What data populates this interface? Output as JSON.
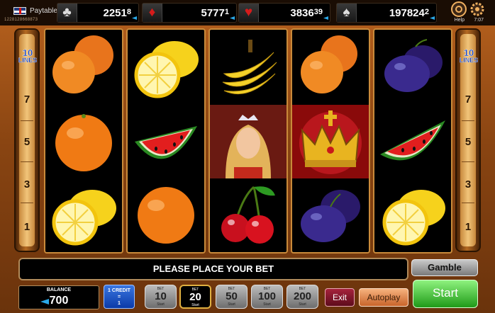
{
  "topbar": {
    "paytable_label": "Paytable",
    "ticket_id": "1228128668873",
    "help_label": "Help",
    "clock": "7:07"
  },
  "jackpots": [
    {
      "suit": "clubs",
      "symbol": "♣",
      "main": "2251",
      "cents": "8"
    },
    {
      "suit": "diamonds",
      "symbol": "♦",
      "main": "5777",
      "cents": "1"
    },
    {
      "suit": "hearts",
      "symbol": "♥",
      "main": "3836",
      "cents": "39"
    },
    {
      "suit": "spades",
      "symbol": "♠",
      "main": "197824",
      "cents": "2"
    }
  ],
  "lines": {
    "count": "10",
    "label": "LINES",
    "numbers": [
      "7",
      "5",
      "3",
      "1"
    ]
  },
  "reels": [
    [
      "orange-symbol",
      "orange-symbol",
      "lemon-symbol"
    ],
    [
      "lemon-symbol",
      "watermelon-symbol",
      "orange-symbol"
    ],
    [
      "banana-symbol",
      "princess-symbol",
      "cherry-symbol"
    ],
    [
      "orange-symbol",
      "crown-symbol",
      "plum-symbol"
    ],
    [
      "plum-symbol",
      "watermelon-symbol",
      "lemon-symbol"
    ]
  ],
  "message": "PLEASE PLACE YOUR BET",
  "gamble_label": "Gamble",
  "balance": {
    "label": "BALANCE",
    "value": "700"
  },
  "credit": {
    "line1": "1 CREDIT",
    "line2": "=",
    "line3": "1"
  },
  "bets": [
    {
      "caption": "BET",
      "value": "10",
      "sub": "Start",
      "selected": false
    },
    {
      "caption": "BET",
      "value": "20",
      "sub": "Start",
      "selected": true
    },
    {
      "caption": "BET",
      "value": "50",
      "sub": "Start",
      "selected": false
    },
    {
      "caption": "BET",
      "value": "100",
      "sub": "Start",
      "selected": false
    },
    {
      "caption": "BET",
      "value": "200",
      "sub": "Start",
      "selected": false
    }
  ],
  "exit_label": "Exit",
  "autoplay_label": "Autoplay",
  "start_label": "Start",
  "colors": {
    "accent_gold": "#e0b040",
    "start_green": "#1f9a18",
    "frame_brown": "#8a4512"
  }
}
